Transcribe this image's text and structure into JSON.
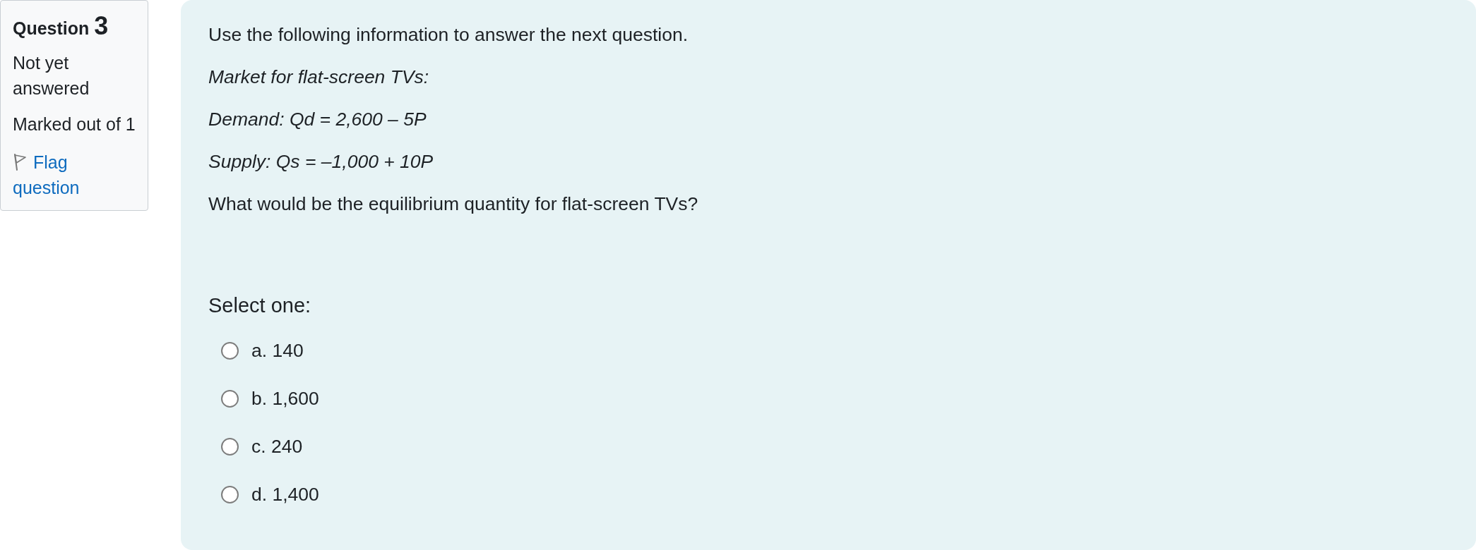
{
  "question_info": {
    "heading": {
      "label": "Question",
      "number": "3"
    },
    "status": "Not yet answered",
    "grade": "Marked out of 1",
    "flag": {
      "label": "Flag question",
      "flagged": false
    }
  },
  "question": {
    "paragraphs": [
      {
        "text": "Use the following information to answer the next question.",
        "italic": false
      },
      {
        "text": "Market for flat-screen TVs:",
        "italic": true
      },
      {
        "text": "Demand: Qd = 2,600 – 5P",
        "italic": true
      },
      {
        "text": "Supply: Qs = –1,000 + 10P",
        "italic": true
      },
      {
        "text": "What would be the equilibrium quantity for flat-screen TVs?",
        "italic": false
      }
    ],
    "prompt": "Select one:",
    "options": [
      {
        "number": "a.",
        "text": "140",
        "selected": false
      },
      {
        "number": "b.",
        "text": "1,600",
        "selected": false
      },
      {
        "number": "c.",
        "text": "240",
        "selected": false
      },
      {
        "number": "d.",
        "text": "1,400",
        "selected": false
      }
    ]
  }
}
